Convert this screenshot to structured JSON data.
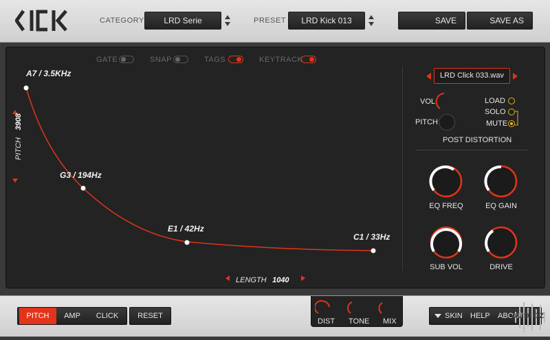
{
  "app": {
    "logo": "KICK"
  },
  "header": {
    "category_label": "CATEGORY",
    "category_value": "LRD Serie",
    "preset_label": "PRESET",
    "preset_value": "LRD Kick 013",
    "save_label": "SAVE",
    "save_as_label": "SAVE AS"
  },
  "toggles": [
    {
      "label": "GATE",
      "on": false
    },
    {
      "label": "SNAP",
      "on": false
    },
    {
      "label": "TAGS",
      "on": true
    },
    {
      "label": "KEYTRACK",
      "on": true
    }
  ],
  "envelope": {
    "points": [
      {
        "label": "A7 / 3.5KHz"
      },
      {
        "label": "G3 / 194Hz"
      },
      {
        "label": "E1 / 42Hz"
      },
      {
        "label": "C1 / 33Hz"
      }
    ],
    "pitch_label": "PITCH",
    "pitch_value": "3908",
    "length_label": "LENGTH",
    "length_value": "1040"
  },
  "click_layer": {
    "sample": "LRD Click 033.wav",
    "vol_label": "VOL",
    "pitch_label": "PITCH",
    "load_label": "LOAD",
    "solo_label": "SOLO",
    "mute_label": "MUTE",
    "selected": "MUTE",
    "post_label": "POST DISTORTION"
  },
  "knobs": [
    {
      "label": "EQ FREQ"
    },
    {
      "label": "EQ GAIN"
    },
    {
      "label": "SUB VOL"
    },
    {
      "label": "DRIVE"
    }
  ],
  "bottom": {
    "tabs": [
      "PITCH",
      "AMP",
      "CLICK"
    ],
    "active_tab": "PITCH",
    "reset_label": "RESET",
    "fx": [
      "DIST",
      "TONE",
      "MIX"
    ],
    "menu": {
      "skin": "SKIN",
      "help": "HELP",
      "about": "ABOUT"
    },
    "watermark": "AUDIOZ"
  },
  "colors": {
    "accent": "#e2341a",
    "radio": "#e8b21a",
    "panel": "#232323"
  }
}
